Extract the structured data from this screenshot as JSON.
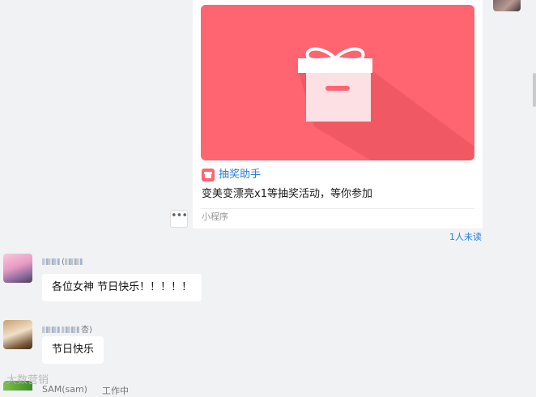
{
  "colors": {
    "background": "#f1f2f4",
    "card_accent": "#ff6471",
    "link_blue": "#2a7fd4",
    "bubble": "#ffffff"
  },
  "mini_program_card": {
    "icon": "gift-icon",
    "app_name": "抽奖助手",
    "description": "变美变漂亮x1等抽奖活动，等你参加",
    "footer": "小程序",
    "read_status": "1人未读"
  },
  "more_button": {
    "label": "•••",
    "icon": "more-dots-icon"
  },
  "messages": [
    {
      "sender_suffix": "(",
      "text": "各位女神  节日快乐！！！！！"
    },
    {
      "sender_suffix": "杏)",
      "text": "节日快乐"
    }
  ],
  "bottom_row": {
    "watermark": "大数营销",
    "sender": "SAM(sam)",
    "status": "工作中"
  }
}
